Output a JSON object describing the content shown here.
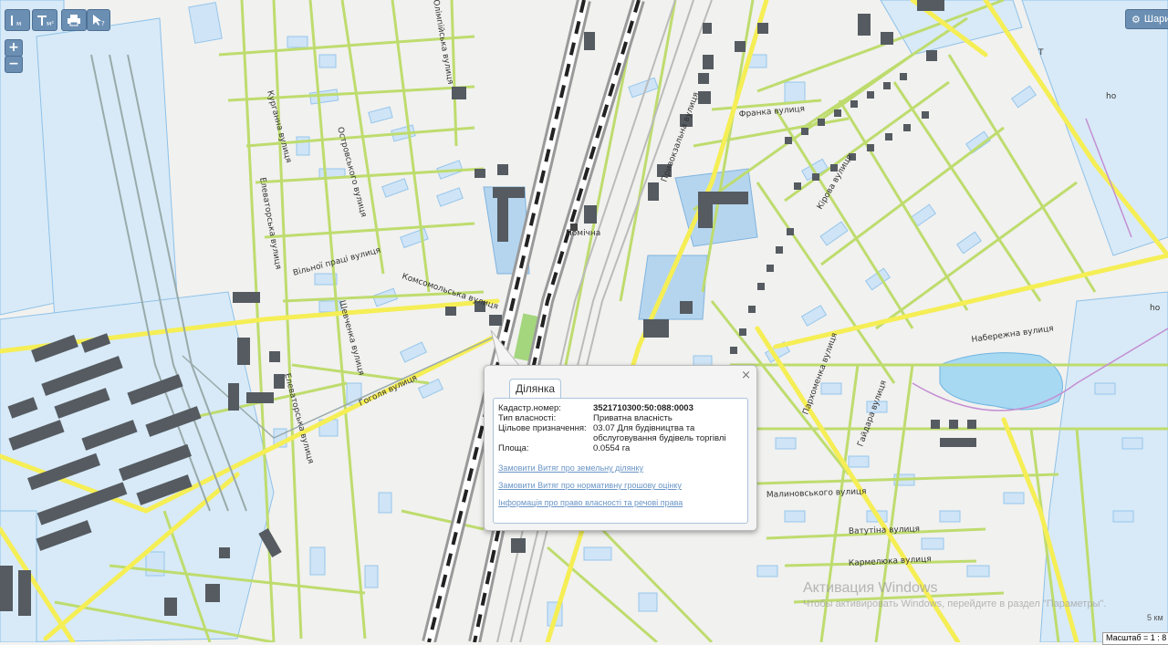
{
  "map": {
    "street_labels": [
      {
        "id": "franka",
        "text": "Франка вулиця"
      },
      {
        "id": "elevatorna1",
        "text": "Елеваторська вулиця"
      },
      {
        "id": "elevatorna2",
        "text": "Елеваторська вулиця"
      },
      {
        "id": "vilni",
        "text": "Вільної праці вулиця"
      },
      {
        "id": "komsomolska",
        "text": "Комсомольська вулиця"
      },
      {
        "id": "shevchenka",
        "text": "Шевченка вулиця"
      },
      {
        "id": "ostrovskoho",
        "text": "Островського вулиця"
      },
      {
        "id": "hoholia",
        "text": "Гоголя вулиця"
      },
      {
        "id": "pryvokzalna",
        "text": "Привокзальна вулиця"
      },
      {
        "id": "naberezhna",
        "text": "Набережна вулиця"
      },
      {
        "id": "malinovskoho",
        "text": "Малиновського вулиця"
      },
      {
        "id": "vatutina",
        "text": "Ватутіна вулиця"
      },
      {
        "id": "karmeliuka",
        "text": "Кармелюка вулиця"
      },
      {
        "id": "haidara",
        "text": "Гайдара вулиця"
      },
      {
        "id": "kirova",
        "text": "Кірова вулиця"
      },
      {
        "id": "parkhomenka",
        "text": "Пархоменка вулиця"
      },
      {
        "id": "olimpiiska",
        "text": "Олімпійська вулиця"
      },
      {
        "id": "kurhanna",
        "text": "Курганна вулиця"
      }
    ],
    "station_label": "Помічна",
    "tiny_mark": "Т",
    "tiny_ho1": "ho",
    "tiny_ho2": "ho"
  },
  "toolbar": {
    "measure_line": "м",
    "measure_area": "м²",
    "print": "print-icon",
    "identify": "identify-icon",
    "settings_label": "Шари"
  },
  "zoom": {
    "in": "+",
    "out": "−"
  },
  "popup": {
    "tab": "Ділянка",
    "close": "×",
    "fields": [
      {
        "label": "Кадастр.номер:",
        "value": "3521710300:50:088:0003",
        "bold": true
      },
      {
        "label": "Тип власності:",
        "value": "Приватна власність",
        "bold": false
      },
      {
        "label": "Цільове призначення:",
        "value": "03.07 Для будівництва та обслуговування будівель торгівлі",
        "bold": false
      },
      {
        "label": "Площа:",
        "value": "0.0554 га",
        "bold": false
      }
    ],
    "links": [
      "Замовити Витяг про земельну ділянку",
      "Замовити Витяг про нормативну грошову оцінку",
      "Інформація про право власності та речові права"
    ]
  },
  "watermark": {
    "title": "Активация Windows",
    "subtitle": "Чтобы активировать Windows, перейдите в раздел \"Параметры\"."
  },
  "scale": {
    "label": "Масштаб = 1 : 8",
    "unit": "5 км"
  },
  "colors": {
    "road_yellow": "#f5ee55",
    "road_green": "#bedc6e",
    "parcel_blue": "#a9cff0",
    "building_dark": "#555b61",
    "water": "#a7d9f2",
    "ui_button": "#6b8fb3"
  }
}
